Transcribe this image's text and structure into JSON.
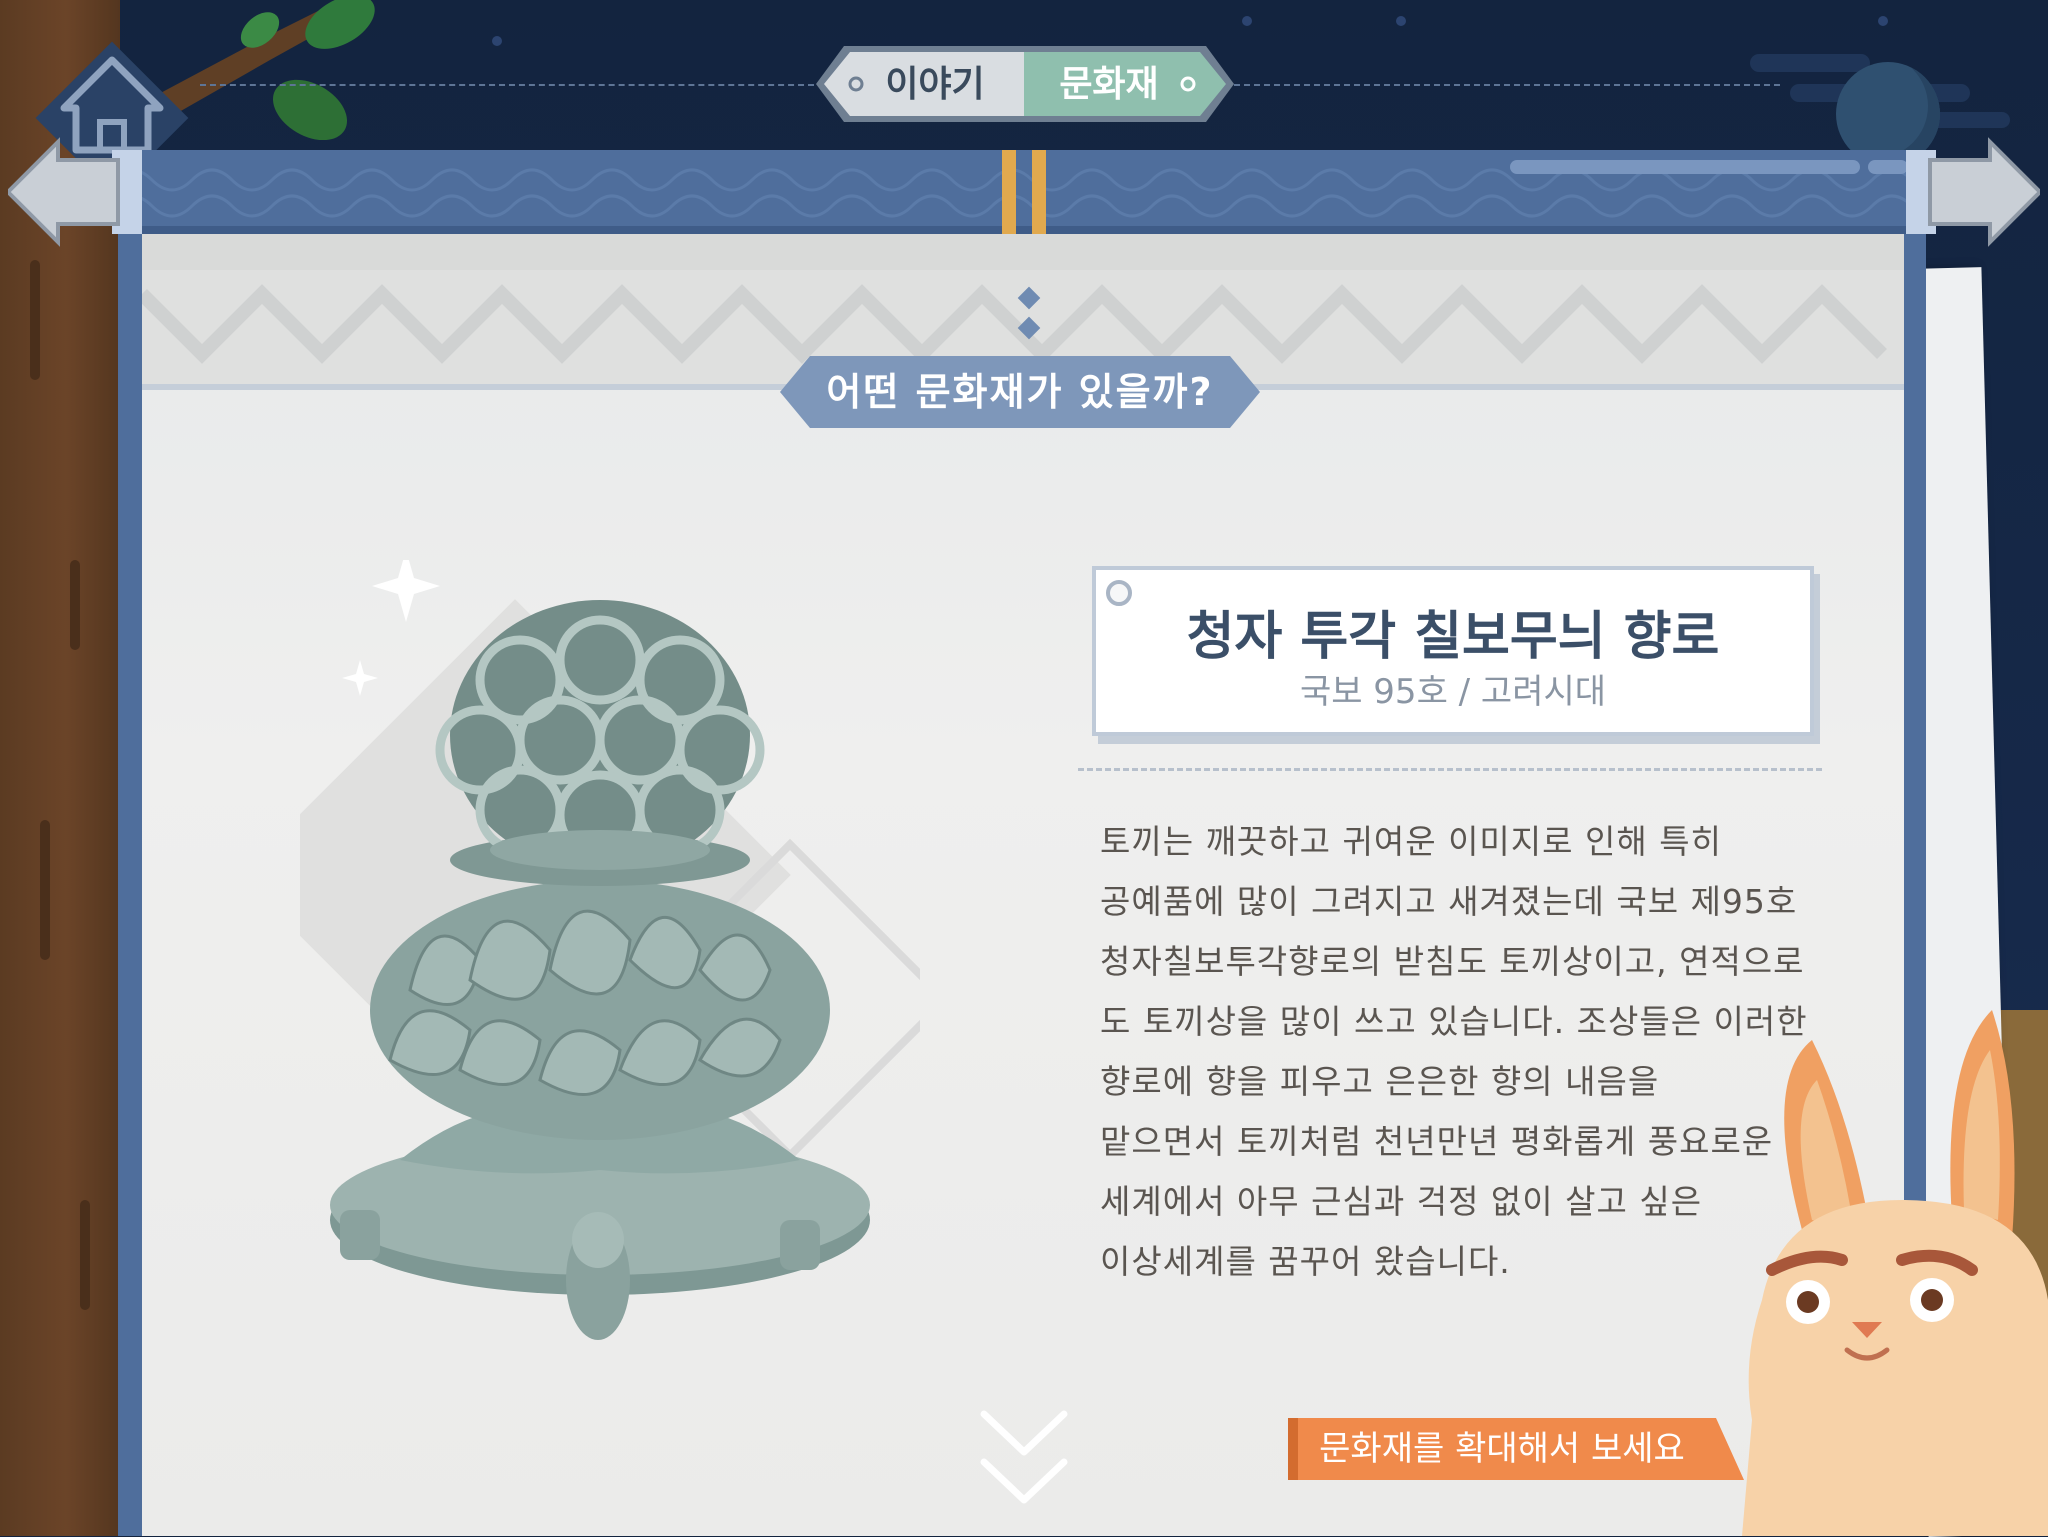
{
  "nav": {
    "tabs": [
      {
        "label": "이야기",
        "active": false
      },
      {
        "label": "문화재",
        "active": true
      }
    ]
  },
  "home": {
    "icon": "home-icon"
  },
  "section_heading": "어떤 문화재가 있을까?",
  "artifact": {
    "name": "청자 투각 칠보무늬 향로",
    "designation": "국보 95호 / 고려시대",
    "description_lines": [
      "토끼는 깨끗하고 귀여운 이미지로 인해 특히",
      "공예품에 많이 그려지고 새겨졌는데 국보 제95호",
      "청자칠보투각향로의 받침도 토끼상이고, 연적으로",
      "도 토끼상을 많이 쓰고 있습니다. 조상들은 이러한",
      "향로에 향을 피우고 은은한 향의 내음을",
      "맡으면서 토끼처럼 천년만년 평화롭게 풍요로운",
      "세계에서 아무 근심과 걱정 없이 살고 싶은",
      "이상세계를 꿈꾸어 왔습니다."
    ]
  },
  "zoom_hint": "문화재를 확대해서 보세요",
  "colors": {
    "sky": "#13243f",
    "scroll_blue": "#4f6e9c",
    "active_tab": "#8fbfae",
    "zoom_banner": "#f08a4b",
    "paper": "#ececeb"
  },
  "icons": [
    "home-icon",
    "chevron-down-icon",
    "sparkle-icon",
    "rabbit-character"
  ]
}
